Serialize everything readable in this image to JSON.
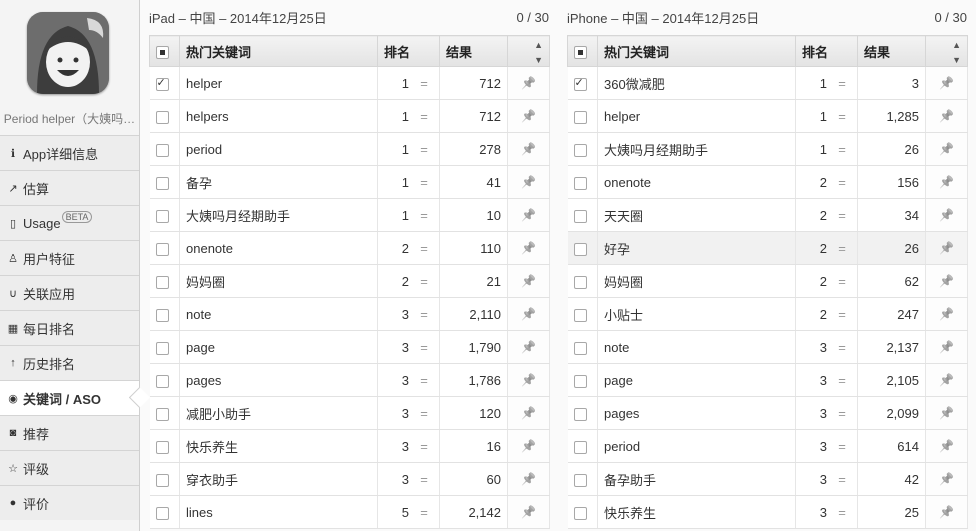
{
  "app": {
    "name": "Period helper（大姨吗…",
    "icon": "app-face-icon"
  },
  "nav": [
    {
      "label": "App详细信息",
      "icon": "info-icon",
      "glyph": "ℹ"
    },
    {
      "label": "估算",
      "icon": "chart-line-icon",
      "glyph": "↗"
    },
    {
      "label": "Usage",
      "icon": "usage-icon",
      "glyph": "▯",
      "badge": "BETA"
    },
    {
      "label": "用户特征",
      "icon": "person-icon",
      "glyph": "♙"
    },
    {
      "label": "关联应用",
      "icon": "stethoscope-icon",
      "glyph": "∪"
    },
    {
      "label": "每日排名",
      "icon": "calendar-icon",
      "glyph": "▦"
    },
    {
      "label": "历史排名",
      "icon": "arrow-up-icon",
      "glyph": "↑"
    },
    {
      "label": "关键词 / ASO",
      "icon": "keyword-icon",
      "glyph": "◉",
      "active": true
    },
    {
      "label": "推荐",
      "icon": "bookmark-icon",
      "glyph": "◙"
    },
    {
      "label": "评级",
      "icon": "star-icon",
      "glyph": "☆"
    },
    {
      "label": "评价",
      "icon": "comment-icon",
      "glyph": "●"
    }
  ],
  "columns": {
    "keyword": "热门关键词",
    "rank": "排名",
    "results": "结果"
  },
  "rank_trend_symbol": "=",
  "panels": {
    "left": {
      "title": "iPad – 中国 – 2014年12月25日",
      "count": "0 / 30",
      "rows": [
        {
          "keyword": "helper",
          "rank": "1",
          "results": "712",
          "checked": true
        },
        {
          "keyword": "helpers",
          "rank": "1",
          "results": "712"
        },
        {
          "keyword": "period",
          "rank": "1",
          "results": "278"
        },
        {
          "keyword": "备孕",
          "rank": "1",
          "results": "41"
        },
        {
          "keyword": "大姨吗月经期助手",
          "rank": "1",
          "results": "10"
        },
        {
          "keyword": "onenote",
          "rank": "2",
          "results": "110"
        },
        {
          "keyword": "妈妈圈",
          "rank": "2",
          "results": "21"
        },
        {
          "keyword": "note",
          "rank": "3",
          "results": "2,110"
        },
        {
          "keyword": "page",
          "rank": "3",
          "results": "1,790"
        },
        {
          "keyword": "pages",
          "rank": "3",
          "results": "1,786"
        },
        {
          "keyword": "减肥小助手",
          "rank": "3",
          "results": "120"
        },
        {
          "keyword": "快乐养生",
          "rank": "3",
          "results": "16"
        },
        {
          "keyword": "穿衣助手",
          "rank": "3",
          "results": "60"
        },
        {
          "keyword": "lines",
          "rank": "5",
          "results": "2,142"
        }
      ]
    },
    "right": {
      "title": "iPhone – 中国 – 2014年12月25日",
      "count": "0 / 30",
      "rows": [
        {
          "keyword": "360微减肥",
          "rank": "1",
          "results": "3",
          "checked": true
        },
        {
          "keyword": "helper",
          "rank": "1",
          "results": "1,285"
        },
        {
          "keyword": "大姨吗月经期助手",
          "rank": "1",
          "results": "26"
        },
        {
          "keyword": "onenote",
          "rank": "2",
          "results": "156"
        },
        {
          "keyword": "天天圈",
          "rank": "2",
          "results": "34"
        },
        {
          "keyword": "好孕",
          "rank": "2",
          "results": "26",
          "hover": true
        },
        {
          "keyword": "妈妈圈",
          "rank": "2",
          "results": "62"
        },
        {
          "keyword": "小贴士",
          "rank": "2",
          "results": "247"
        },
        {
          "keyword": "note",
          "rank": "3",
          "results": "2,137"
        },
        {
          "keyword": "page",
          "rank": "3",
          "results": "2,105"
        },
        {
          "keyword": "pages",
          "rank": "3",
          "results": "2,099"
        },
        {
          "keyword": "period",
          "rank": "3",
          "results": "614"
        },
        {
          "keyword": "备孕助手",
          "rank": "3",
          "results": "42"
        },
        {
          "keyword": "快乐养生",
          "rank": "3",
          "results": "25"
        }
      ]
    }
  }
}
